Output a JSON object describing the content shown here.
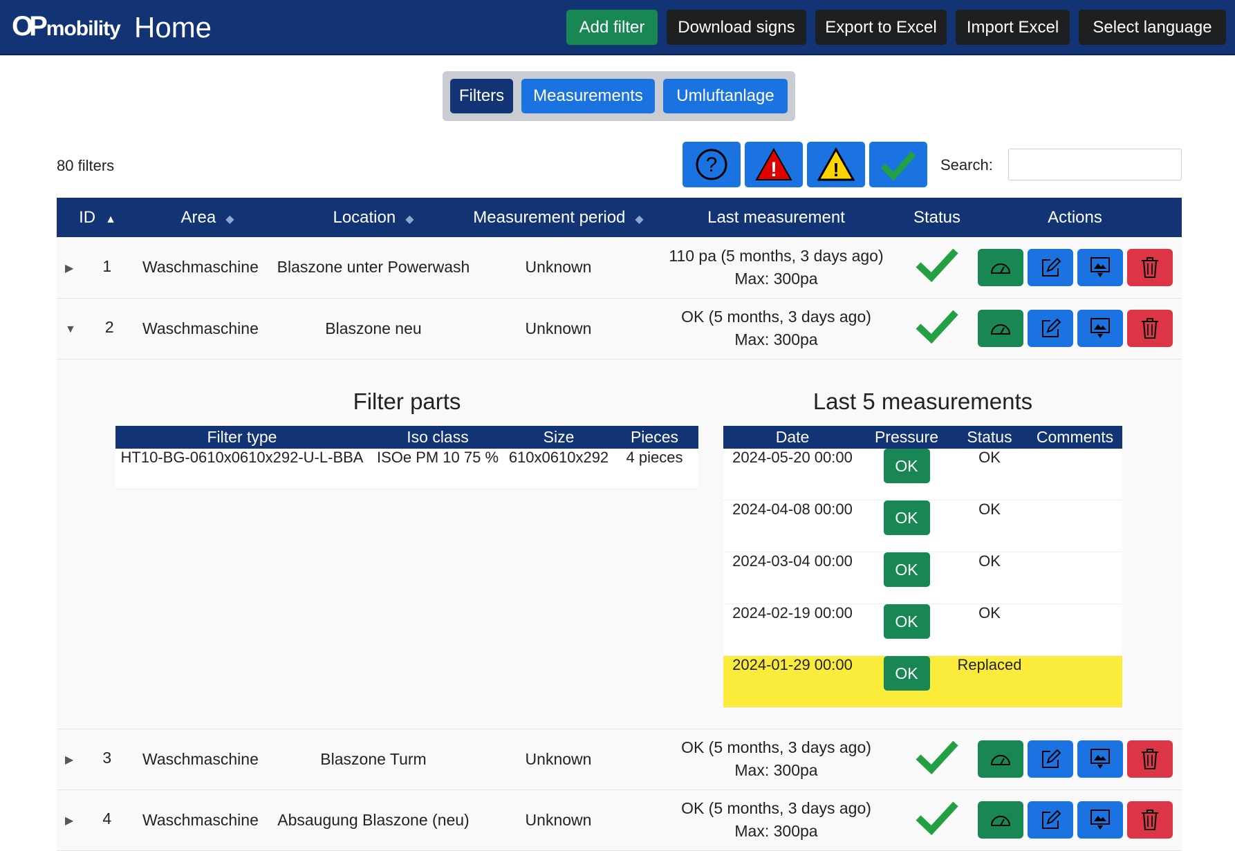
{
  "header": {
    "logo": "OPmobility",
    "title": "Home",
    "buttons": [
      "Add filter",
      "Download signs",
      "Export to Excel",
      "Import Excel",
      "Select language"
    ]
  },
  "tabs": [
    "Filters",
    "Measurements",
    "Umluftanlage"
  ],
  "count": "80 filters",
  "status_filters": [
    "help-icon",
    "error-icon",
    "warning-icon",
    "ok-icon"
  ],
  "search": {
    "label": "Search:",
    "value": ""
  },
  "columns": [
    "ID",
    "Area",
    "Location",
    "Measurement period",
    "Last measurement",
    "Status",
    "Actions"
  ],
  "rows": [
    {
      "id": "1",
      "area": "Waschmaschine",
      "location": "Blaszone unter Powerwash",
      "period": "Unknown",
      "last": "110 pa (5 months, 3 days ago)",
      "max": "Max: 300pa",
      "expanded": false
    },
    {
      "id": "2",
      "area": "Waschmaschine",
      "location": "Blaszone neu",
      "period": "Unknown",
      "last": "OK (5 months, 3 days ago)",
      "max": "Max: 300pa",
      "expanded": true
    },
    {
      "id": "3",
      "area": "Waschmaschine",
      "location": "Blaszone Turm",
      "period": "Unknown",
      "last": "OK (5 months, 3 days ago)",
      "max": "Max: 300pa",
      "expanded": false
    },
    {
      "id": "4",
      "area": "Waschmaschine",
      "location": "Absaugung Blaszone (neu)",
      "period": "Unknown",
      "last": "OK (5 months, 3 days ago)",
      "max": "Max: 300pa",
      "expanded": false
    }
  ],
  "detail": {
    "parts_title": "Filter parts",
    "parts_columns": [
      "Filter type",
      "Iso class",
      "Size",
      "Pieces"
    ],
    "parts": [
      [
        "HT10-BG-0610x0610x292-U-L-BBA",
        "ISOe PM 10 75 %",
        "610x0610x292",
        "4 pieces"
      ]
    ],
    "meas_title": "Last 5 measurements",
    "meas_columns": [
      "Date",
      "Pressure",
      "Status",
      "Comments"
    ],
    "measurements": [
      {
        "date": "2024-05-20 00:00",
        "pressure": "OK",
        "status": "OK",
        "comments": "",
        "highlight": false
      },
      {
        "date": "2024-04-08 00:00",
        "pressure": "OK",
        "status": "OK",
        "comments": "",
        "highlight": false
      },
      {
        "date": "2024-03-04 00:00",
        "pressure": "OK",
        "status": "OK",
        "comments": "",
        "highlight": false
      },
      {
        "date": "2024-02-19 00:00",
        "pressure": "OK",
        "status": "OK",
        "comments": "",
        "highlight": false
      },
      {
        "date": "2024-01-29 00:00",
        "pressure": "OK",
        "status": "Replaced",
        "comments": "",
        "highlight": true
      }
    ]
  },
  "colors": {
    "navy": "#123474",
    "green": "#198754",
    "blue": "#1a73e0",
    "red": "#dc3545",
    "highlight": "#fbeb3a"
  }
}
